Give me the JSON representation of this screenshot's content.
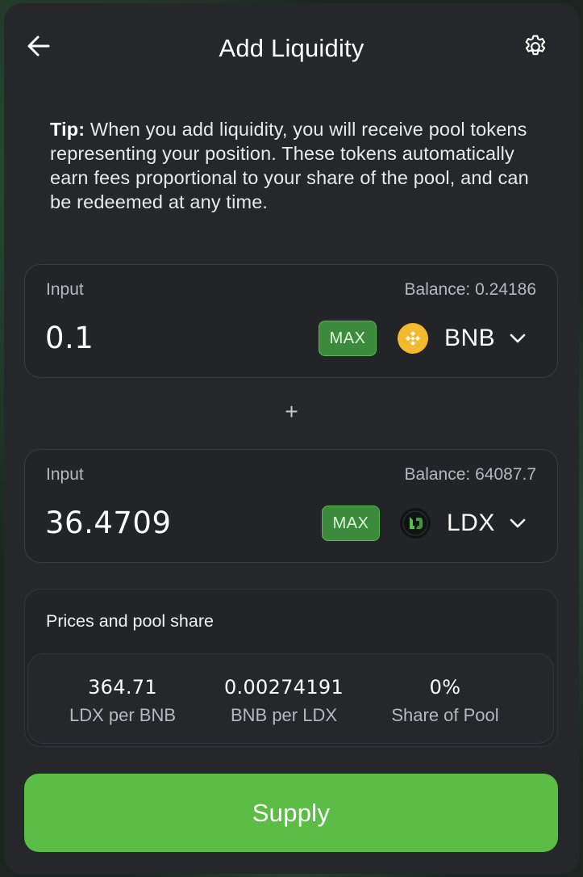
{
  "header": {
    "title": "Add Liquidity",
    "back_icon": "arrow-left-icon",
    "settings_icon": "gear-icon"
  },
  "tip": {
    "label": "Tip:",
    "text": " When you add liquidity, you will receive pool tokens representing your position. These tokens automatically earn fees proportional to your share of the pool, and can be redeemed at any time."
  },
  "input_a": {
    "label": "Input",
    "balance": "Balance: 0.24186",
    "value": "0.1",
    "max_label": "MAX",
    "token_symbol": "BNB",
    "token_icon": "bnb-token-icon",
    "token_color": "#F3BA2F"
  },
  "plus_sign": "+",
  "input_b": {
    "label": "Input",
    "balance": "Balance: 64087.7",
    "value": "36.4709",
    "max_label": "MAX",
    "token_symbol": "LDX",
    "token_icon": "ldx-token-icon",
    "token_color": "#5BBD45"
  },
  "prices": {
    "title": "Prices and pool share",
    "stats": [
      {
        "value": "364.71",
        "label": "LDX per BNB"
      },
      {
        "value": "0.00274191",
        "label": "BNB per LDX"
      },
      {
        "value": "0%",
        "label": "Share of Pool"
      }
    ]
  },
  "supply": {
    "label": "Supply"
  },
  "colors": {
    "accent": "#5BBD45",
    "max_bg": "#3C8A3C",
    "panel": "#26272B"
  }
}
